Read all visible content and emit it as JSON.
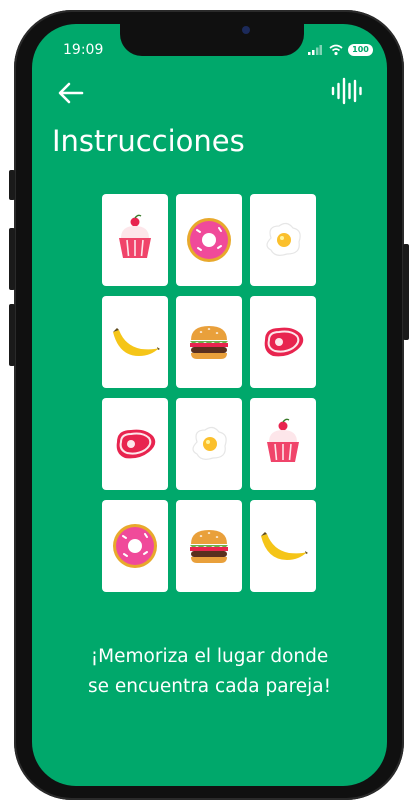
{
  "status": {
    "time": "19:09",
    "battery": "100"
  },
  "header": {
    "title": "Instrucciones",
    "back_icon": "back-arrow-icon",
    "audio_icon": "audio-wave-icon"
  },
  "grid": {
    "rows": [
      [
        "cupcake",
        "donut",
        "egg"
      ],
      [
        "banana",
        "burger",
        "steak"
      ],
      [
        "steak",
        "egg",
        "cupcake"
      ],
      [
        "donut",
        "burger",
        "banana"
      ]
    ]
  },
  "message": {
    "line1": "¡Memoriza el lugar donde",
    "line2": "se encuentra cada pareja!"
  },
  "colors": {
    "background": "#00a86b",
    "card": "#ffffff",
    "text": "#ffffff"
  }
}
